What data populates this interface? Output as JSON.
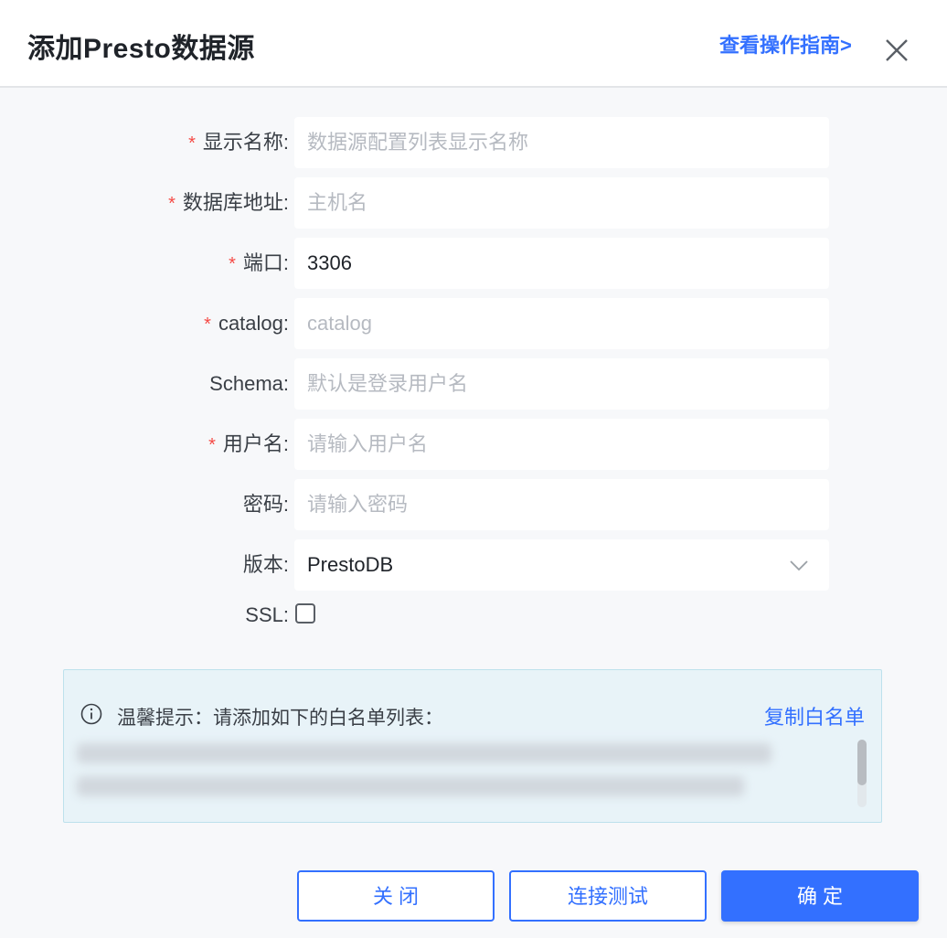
{
  "dialog": {
    "title": "添加Presto数据源",
    "guide_link": "查看操作指南>"
  },
  "form": {
    "fields": [
      {
        "label": "显示名称:",
        "required": true,
        "value": "",
        "placeholder": "数据源配置列表显示名称"
      },
      {
        "label": "数据库地址:",
        "required": true,
        "value": "",
        "placeholder": "主机名"
      },
      {
        "label": "端口:",
        "required": true,
        "value": "3306",
        "placeholder": ""
      },
      {
        "label": "catalog:",
        "required": true,
        "value": "",
        "placeholder": "catalog"
      },
      {
        "label": "Schema:",
        "required": false,
        "value": "",
        "placeholder": "默认是登录用户名"
      },
      {
        "label": "用户名:",
        "required": true,
        "value": "",
        "placeholder": "请输入用户名"
      },
      {
        "label": "密码:",
        "required": false,
        "value": "",
        "placeholder": "请输入密码"
      }
    ],
    "version": {
      "label": "版本:",
      "value": "PrestoDB"
    },
    "ssl": {
      "label": "SSL:",
      "checked": false
    },
    "required_mark": "*"
  },
  "tip": {
    "text": "温馨提示：请添加如下的白名单列表：",
    "copy_label": "复制白名单"
  },
  "footer": {
    "close_label": "关 闭",
    "test_label": "连接测试",
    "confirm_label": "确 定"
  },
  "colors": {
    "accent": "#3370ff",
    "required": "#f54a45",
    "tip_bg": "#e8f3f8"
  },
  "icons": [
    "close-icon",
    "chevron-down-icon",
    "info-icon"
  ]
}
